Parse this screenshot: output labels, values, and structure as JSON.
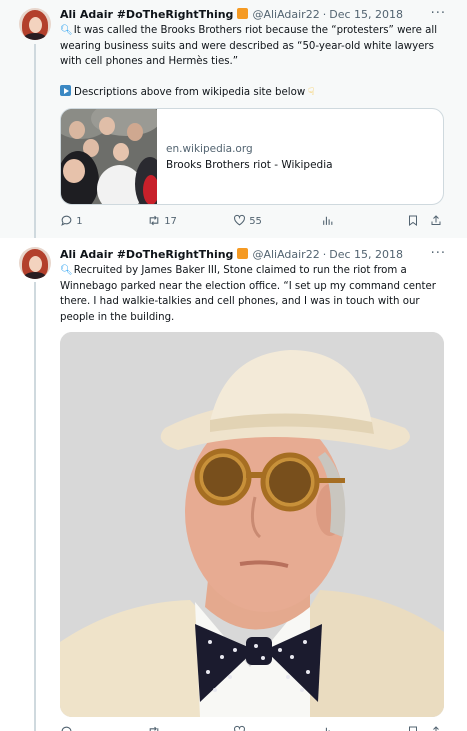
{
  "colors": {
    "accent": "#1d9bf0",
    "text": "#0f1419",
    "muted": "#536471",
    "badge": "#f59a23",
    "border": "#cfd9de"
  },
  "tweets": [
    {
      "author": {
        "name": "Ali Adair #DoTheRightThing",
        "handle": "@AliAdair22",
        "separator": "·",
        "date": "Dec 15, 2018"
      },
      "more": "···",
      "lines": [
        "It was called the Brooks Brothers riot because the “protesters” were all",
        "wearing business suits and were described as “50-year-old white lawyers",
        "with cell phones and Hermès ties.”",
        "Descriptions above from wikipedia site below"
      ],
      "card": {
        "domain": "en.wikipedia.org",
        "title": "Brooks Brothers riot - Wikipedia"
      },
      "actions": {
        "replies": "1",
        "retweets": "17",
        "likes": "55"
      }
    },
    {
      "author": {
        "name": "Ali Adair #DoTheRightThing",
        "handle": "@AliAdair22",
        "separator": "·",
        "date": "Dec 15, 2018"
      },
      "more": "···",
      "lines": [
        "Recruited by James Baker III, Stone claimed to run the riot from a",
        "Winnebago parked near the election office. “I set up my command center",
        "there. I had walkie-talkies and cell phones, and I was in touch with our",
        "people in the building."
      ]
    }
  ],
  "icons": {
    "reply": "reply-icon",
    "retweet": "retweet-icon",
    "like": "heart-icon",
    "views": "analytics-icon",
    "bookmark": "bookmark-icon",
    "share": "share-icon",
    "magnifier": "magnifying-glass-emoji",
    "play": "play-button-emoji",
    "point": "backhand-index-pointing-down-emoji"
  }
}
